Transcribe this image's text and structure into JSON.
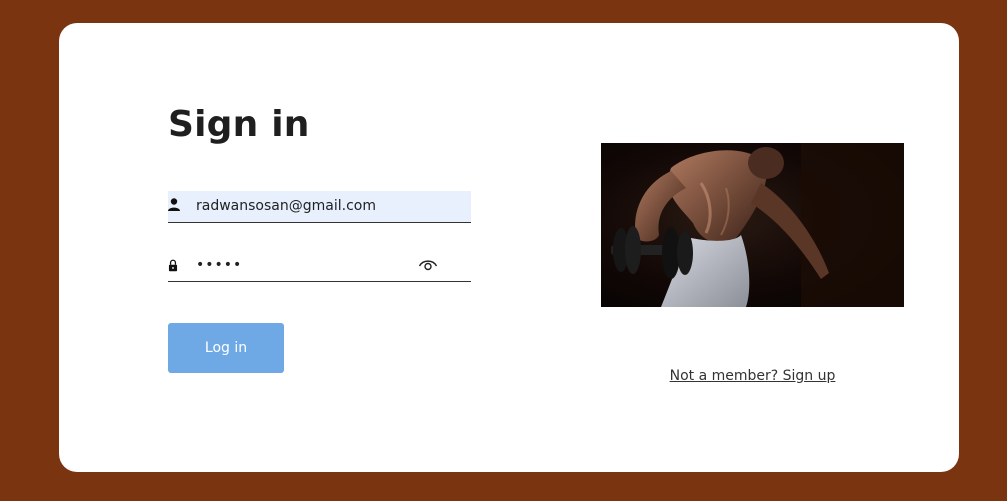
{
  "page": {
    "title": "Sign in"
  },
  "form": {
    "email": {
      "value": "radwansosan@gmail.com",
      "icon": "user-icon"
    },
    "password": {
      "value": "•••••",
      "icon": "lock-icon",
      "toggle_icon": "eye-icon"
    },
    "login_label": "Log in"
  },
  "side": {
    "image_name": "fitness-hero-image",
    "signup_text": "Not a member? Sign up"
  },
  "colors": {
    "background": "#7a3510",
    "card": "#ffffff",
    "button": "#6ea9e6",
    "autofill": "#e8f0fe"
  }
}
